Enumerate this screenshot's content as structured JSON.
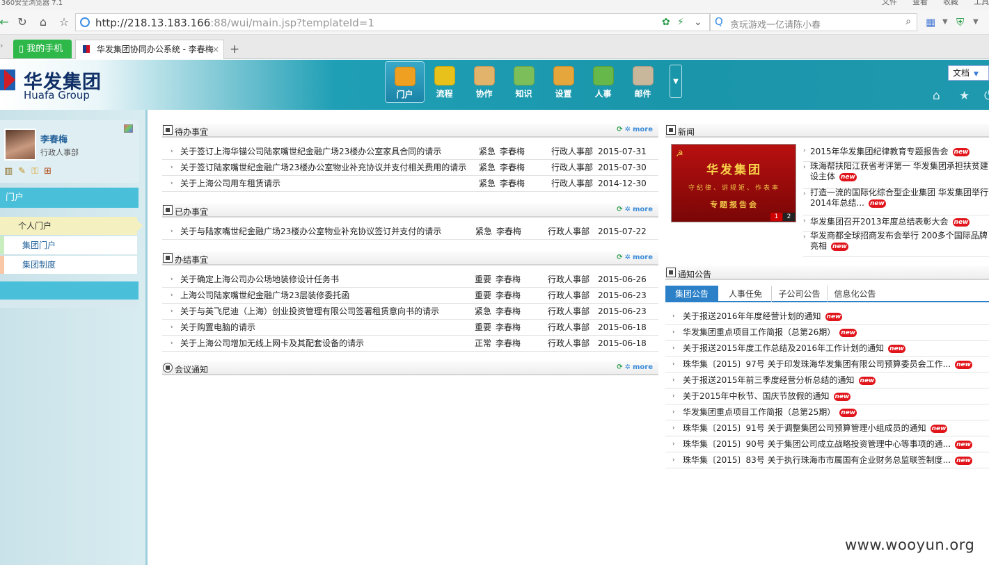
{
  "browser": {
    "title_bar": "360安全浏览器 7.1",
    "menu": [
      "文件",
      "查看",
      "收藏",
      "工具"
    ],
    "url_host": "http://218.13.183.166",
    "url_rest": ":88/wui/main.jsp?templateId=1",
    "search_placeholder": "贪玩游戏一亿请陈小春",
    "tab_phone": "我的手机",
    "tab_main": "华发集团协同办公系统 - 李春梅"
  },
  "app": {
    "logo_cn": "华发集团",
    "logo_en": "Huafa Group",
    "modules": [
      {
        "label": "门户",
        "color": "#f0a020"
      },
      {
        "label": "流程",
        "color": "#e8c21a"
      },
      {
        "label": "协作",
        "color": "#e2b36b"
      },
      {
        "label": "知识",
        "color": "#7cbf5a"
      },
      {
        "label": "设置",
        "color": "#e5a63b"
      },
      {
        "label": "人事",
        "color": "#67b84a"
      },
      {
        "label": "邮件",
        "color": "#c9b79c"
      }
    ],
    "doc_select": "文档"
  },
  "user": {
    "name": "李春梅",
    "dept": "行政人事部"
  },
  "sidebar": {
    "header": "门户",
    "items": [
      "个人门户",
      "集团门户",
      "集团制度"
    ]
  },
  "panels": {
    "todo": {
      "title": "待办事宜",
      "more": "more",
      "rows": [
        {
          "title": "关于签订上海华锚公司陆家嘴世纪金融广场23楼办公室家具合同的请示",
          "priority": "紧急",
          "user": "李春梅",
          "dept": "行政人事部",
          "date": "2015-07-31"
        },
        {
          "title": "关于签订陆家嘴世纪金融广场23楼办公室物业补充协议并支付相关费用的请示",
          "priority": "紧急",
          "user": "李春梅",
          "dept": "行政人事部",
          "date": "2015-07-30"
        },
        {
          "title": "关于上海公司用车租赁请示",
          "priority": "紧急",
          "user": "李春梅",
          "dept": "行政人事部",
          "date": "2014-12-30"
        }
      ]
    },
    "done": {
      "title": "已办事宜",
      "more": "more",
      "rows": [
        {
          "title": "关于与陆家嘴世纪金融广场23楼办公室物业补充协议签订并支付的请示",
          "priority": "紧急",
          "user": "李春梅",
          "dept": "行政人事部",
          "date": "2015-07-22"
        }
      ]
    },
    "finished": {
      "title": "办结事宜",
      "more": "more",
      "rows": [
        {
          "title": "关于确定上海公司办公场地装修设计任务书",
          "priority": "重要",
          "user": "李春梅",
          "dept": "行政人事部",
          "date": "2015-06-26"
        },
        {
          "title": "上海公司陆家嘴世纪金融广场23层装修委托函",
          "priority": "重要",
          "user": "李春梅",
          "dept": "行政人事部",
          "date": "2015-06-23"
        },
        {
          "title": "关于与英飞尼迪（上海）创业投资管理有限公司签署租赁意向书的请示",
          "priority": "紧急",
          "user": "李春梅",
          "dept": "行政人事部",
          "date": "2015-06-23"
        },
        {
          "title": "关于购置电脑的请示",
          "priority": "重要",
          "user": "李春梅",
          "dept": "行政人事部",
          "date": "2015-06-18"
        },
        {
          "title": "关于上海公司增加无线上网卡及其配套设备的请示",
          "priority": "正常",
          "user": "李春梅",
          "dept": "行政人事部",
          "date": "2015-06-18"
        }
      ]
    },
    "meeting": {
      "title": "会议通知",
      "more": "more"
    },
    "news": {
      "title": "新闻",
      "image_text": [
        "华发集团",
        "守纪律、讲规矩、作表率",
        "专题报告会"
      ],
      "image_pages": [
        "1",
        "2"
      ],
      "new_label": "new",
      "items": [
        "2015年华发集团纪律教育专题报告会",
        "珠海帮扶阳江获省考评第一 华发集团承担扶贫建设主体",
        "打造一流的国际化综合型企业集团 华发集团举行2014年总结...",
        "华发集团召开2013年度总结表彰大会",
        "华发商都全球招商发布会举行 200多个国际品牌亮相"
      ]
    },
    "notice": {
      "title": "通知公告",
      "tabs": [
        "集团公告",
        "人事任免",
        "子公司公告",
        "信息化公告"
      ],
      "items": [
        "关于报送2016年年度经营计划的通知",
        "华发集团重点项目工作简报（总第26期）",
        "关于报送2015年度工作总结及2016年工作计划的通知",
        "珠华集〔2015〕97号 关于印发珠海华发集团有限公司预算委员会工作...",
        "关于报送2015年前三季度经营分析总结的通知",
        "关于2015年中秋节、国庆节放假的通知",
        "华发集团重点项目工作简报（总第25期）",
        "珠华集〔2015〕91号 关于调整集团公司预算管理小组成员的通知",
        "珠华集〔2015〕90号 关于集团公司成立战略投资管理中心等事项的通...",
        "珠华集〔2015〕83号 关于执行珠海市市属国有企业财务总监联签制度..."
      ]
    }
  },
  "watermark": "www.wooyun.org"
}
